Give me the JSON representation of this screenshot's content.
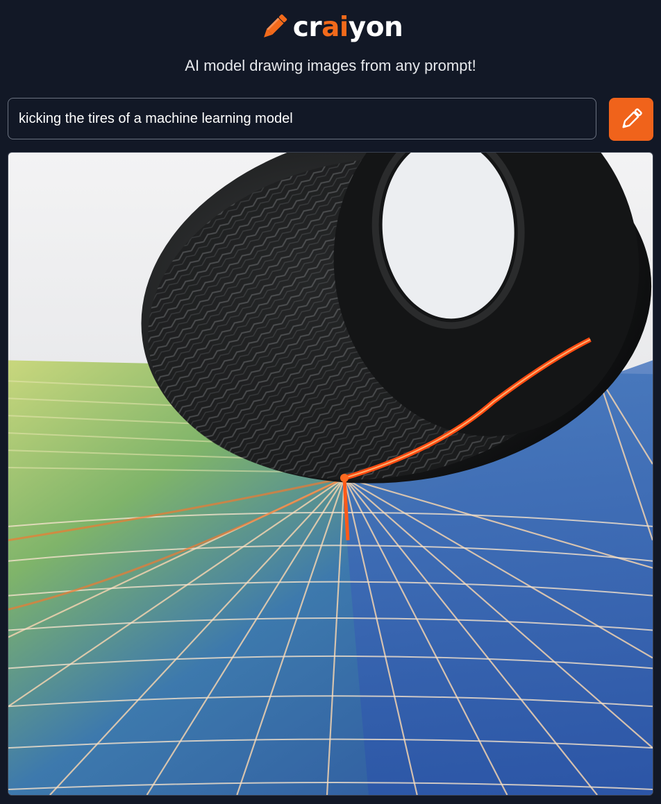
{
  "brand": {
    "name_part1": "cr",
    "name_accent": "ai",
    "name_part2": "yon",
    "accent_color": "#f26a1b"
  },
  "tagline": "AI model drawing images from any prompt!",
  "prompt": {
    "value": "kicking the tires of a machine learning model",
    "placeholder": ""
  },
  "draw_button": {
    "icon": "pencil-icon",
    "color": "#f0631b"
  },
  "result_image": {
    "alt": "kicking the tires of a machine learning model"
  },
  "colors": {
    "background": "#121826",
    "text": "#e6e8ec",
    "accent": "#f26a1b"
  }
}
